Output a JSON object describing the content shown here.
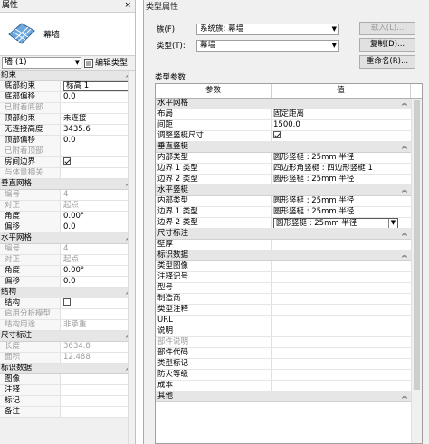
{
  "left_panel": {
    "title": "属性",
    "close": "×",
    "type_name": "幕墙",
    "instance_filter": "墙 (1)",
    "edit_type_label": "编辑类型",
    "groups": [
      {
        "label": "约束",
        "rows": [
          {
            "k": "底部约束",
            "v": "标高 1",
            "boxed": true
          },
          {
            "k": "底部偏移",
            "v": "0.0"
          },
          {
            "k": "已附着底部",
            "v": "",
            "dis": true
          },
          {
            "k": "顶部约束",
            "v": "未连接"
          },
          {
            "k": "无连接高度",
            "v": "3435.6"
          },
          {
            "k": "顶部偏移",
            "v": "0.0"
          },
          {
            "k": "已附着顶部",
            "v": "",
            "dis": true
          },
          {
            "k": "房间边界",
            "v": "",
            "check": true
          },
          {
            "k": "与体量相关",
            "v": "",
            "dis": true
          }
        ]
      },
      {
        "label": "垂直网格",
        "rows": [
          {
            "k": "编号",
            "v": "4",
            "dis": true
          },
          {
            "k": "对正",
            "v": "起点",
            "dis": true
          },
          {
            "k": "角度",
            "v": "0.00°"
          },
          {
            "k": "偏移",
            "v": "0.0"
          }
        ]
      },
      {
        "label": "水平网格",
        "rows": [
          {
            "k": "编号",
            "v": "4",
            "dis": true
          },
          {
            "k": "对正",
            "v": "起点",
            "dis": true
          },
          {
            "k": "角度",
            "v": "0.00°"
          },
          {
            "k": "偏移",
            "v": "0.0"
          }
        ]
      },
      {
        "label": "结构",
        "rows": [
          {
            "k": "结构",
            "v": "",
            "check": false
          },
          {
            "k": "启用分析模型",
            "v": "",
            "dis": true
          },
          {
            "k": "结构用途",
            "v": "非承重",
            "dis": true
          }
        ]
      },
      {
        "label": "尺寸标注",
        "rows": [
          {
            "k": "长度",
            "v": "3634.8",
            "dis": true
          },
          {
            "k": "面积",
            "v": "12.488",
            "dis": true
          }
        ]
      },
      {
        "label": "标识数据",
        "rows": [
          {
            "k": "图像",
            "v": ""
          },
          {
            "k": "注释",
            "v": ""
          },
          {
            "k": "标记",
            "v": ""
          },
          {
            "k": "备注",
            "v": ""
          }
        ]
      }
    ]
  },
  "dialog": {
    "title": "类型属性",
    "family_label": "族(F):",
    "family_value": "系统族: 幕墙",
    "type_label": "类型(T):",
    "type_value": "幕墙",
    "load_btn": "载入(L)...",
    "dup_btn": "复制(D)...",
    "rename_btn": "重命名(R)...",
    "type_params_label": "类型参数",
    "col_param": "参数",
    "col_value": "值",
    "groups": [
      {
        "label": "水平网格",
        "rows": [
          {
            "k": "布局",
            "v": "固定距离"
          },
          {
            "k": "间距",
            "v": "1500.0"
          },
          {
            "k": "调整竖梃尺寸",
            "v": "",
            "check": true
          }
        ]
      },
      {
        "label": "垂直竖梃",
        "rows": [
          {
            "k": "内部类型",
            "v": "圆形竖梃 : 25mm 半径"
          },
          {
            "k": "边界 1 类型",
            "v": "四边形角竖梃 : 四边形竖梃 1"
          },
          {
            "k": "边界 2 类型",
            "v": "圆形竖梃 : 25mm 半径"
          }
        ]
      },
      {
        "label": "水平竖梃",
        "rows": [
          {
            "k": "内部类型",
            "v": "圆形竖梃 : 25mm 半径"
          },
          {
            "k": "边界 1 类型",
            "v": "圆形竖梃 : 25mm 半径"
          },
          {
            "k": "边界 2 类型",
            "v": "圆形竖梃 : 25mm 半径",
            "select": true
          }
        ]
      },
      {
        "label": "尺寸标注",
        "rows": [
          {
            "k": "壁厚",
            "v": ""
          }
        ]
      },
      {
        "label": "标识数据",
        "rows": [
          {
            "k": "类型图像",
            "v": ""
          },
          {
            "k": "注释记号",
            "v": ""
          },
          {
            "k": "型号",
            "v": ""
          },
          {
            "k": "制造商",
            "v": ""
          },
          {
            "k": "类型注释",
            "v": ""
          },
          {
            "k": "URL",
            "v": ""
          },
          {
            "k": "说明",
            "v": ""
          },
          {
            "k": "部件说明",
            "v": "",
            "dis": true
          },
          {
            "k": "部件代码",
            "v": ""
          },
          {
            "k": "类型标记",
            "v": ""
          },
          {
            "k": "防火等级",
            "v": ""
          },
          {
            "k": "成本",
            "v": ""
          }
        ]
      },
      {
        "label": "其他",
        "rows": []
      }
    ]
  }
}
